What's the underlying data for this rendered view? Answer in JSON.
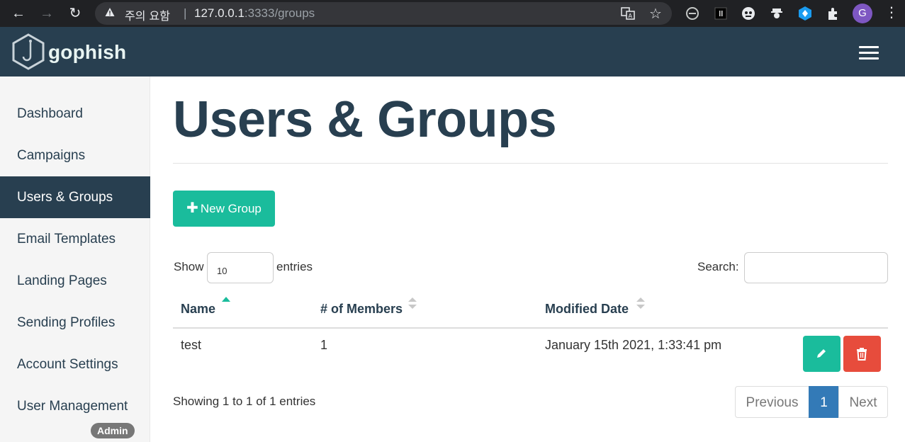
{
  "browser": {
    "warning_text": "주의 요함",
    "url_host": "127.0.0.1",
    "url_port_path": ":3333/groups",
    "profile_initial": "G"
  },
  "app": {
    "brand": "gophish"
  },
  "sidebar": {
    "items": [
      {
        "label": "Dashboard"
      },
      {
        "label": "Campaigns"
      },
      {
        "label": "Users & Groups"
      },
      {
        "label": "Email Templates"
      },
      {
        "label": "Landing Pages"
      },
      {
        "label": "Sending Profiles"
      },
      {
        "label": "Account Settings"
      },
      {
        "label": "User Management"
      }
    ],
    "active_index": 2,
    "admin_badge": "Admin"
  },
  "main": {
    "title": "Users & Groups",
    "new_button": "New Group",
    "show_label": "Show",
    "page_length": "10",
    "entries_label": "entries",
    "search_label": "Search:",
    "search_value": "",
    "table": {
      "headers": [
        "Name",
        "# of Members",
        "Modified Date"
      ],
      "rows": [
        {
          "name": "test",
          "members": "1",
          "modified": "January 15th 2021, 1:33:41 pm"
        }
      ]
    },
    "info": "Showing 1 to 1 of 1 entries",
    "pagination": {
      "previous": "Previous",
      "current": "1",
      "next": "Next"
    }
  },
  "colors": {
    "navy": "#283f50",
    "teal": "#1abc9c",
    "red": "#e74c3c",
    "blue": "#337ab7"
  }
}
